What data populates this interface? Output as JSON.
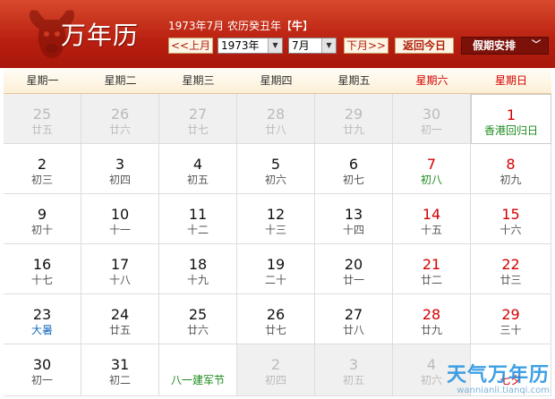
{
  "header": {
    "app_title": "万年历",
    "lunar_info_prefix": "1973年7月 农历癸丑年【",
    "zodiac": "牛",
    "lunar_info_suffix": "】",
    "prev_month_label": "<<上月",
    "next_month_label": "下月>>",
    "today_label": "返回今日",
    "holiday_label": "假期安排",
    "year_value": "1973年",
    "month_value": "7月"
  },
  "weekdays": [
    "星期一",
    "星期二",
    "星期三",
    "星期四",
    "星期五",
    "星期六",
    "星期日"
  ],
  "weeks": [
    [
      {
        "day": "25",
        "lunar": "廿五",
        "other": true
      },
      {
        "day": "26",
        "lunar": "廿六",
        "other": true
      },
      {
        "day": "27",
        "lunar": "廿七",
        "other": true
      },
      {
        "day": "28",
        "lunar": "廿八",
        "other": true
      },
      {
        "day": "29",
        "lunar": "廿九",
        "other": true
      },
      {
        "day": "30",
        "lunar": "初一",
        "other": true
      },
      {
        "day": "1",
        "lunar": "香港回归日",
        "kind": "festival"
      }
    ],
    [
      {
        "day": "2",
        "lunar": "初三"
      },
      {
        "day": "3",
        "lunar": "初四"
      },
      {
        "day": "4",
        "lunar": "初五"
      },
      {
        "day": "5",
        "lunar": "初六"
      },
      {
        "day": "6",
        "lunar": "初七"
      },
      {
        "day": "7",
        "lunar": "初八",
        "kind": "festival"
      },
      {
        "day": "8",
        "lunar": "初九"
      }
    ],
    [
      {
        "day": "9",
        "lunar": "初十"
      },
      {
        "day": "10",
        "lunar": "十一"
      },
      {
        "day": "11",
        "lunar": "十二"
      },
      {
        "day": "12",
        "lunar": "十三"
      },
      {
        "day": "13",
        "lunar": "十四"
      },
      {
        "day": "14",
        "lunar": "十五"
      },
      {
        "day": "15",
        "lunar": "十六"
      }
    ],
    [
      {
        "day": "16",
        "lunar": "十七"
      },
      {
        "day": "17",
        "lunar": "十八"
      },
      {
        "day": "18",
        "lunar": "十九"
      },
      {
        "day": "19",
        "lunar": "二十"
      },
      {
        "day": "20",
        "lunar": "廿一"
      },
      {
        "day": "21",
        "lunar": "廿二"
      },
      {
        "day": "22",
        "lunar": "廿三"
      }
    ],
    [
      {
        "day": "23",
        "lunar": "大暑",
        "kind": "solar-term"
      },
      {
        "day": "24",
        "lunar": "廿五"
      },
      {
        "day": "25",
        "lunar": "廿六"
      },
      {
        "day": "26",
        "lunar": "廿七"
      },
      {
        "day": "27",
        "lunar": "廿八"
      },
      {
        "day": "28",
        "lunar": "廿九"
      },
      {
        "day": "29",
        "lunar": "三十"
      }
    ],
    [
      {
        "day": "30",
        "lunar": "初一"
      },
      {
        "day": "31",
        "lunar": "初二"
      },
      {
        "day": "",
        "lunar": "八一建军节",
        "kind": "festival"
      },
      {
        "day": "2",
        "lunar": "初四",
        "other": true
      },
      {
        "day": "3",
        "lunar": "初五",
        "other": true
      },
      {
        "day": "4",
        "lunar": "初六",
        "other": true
      },
      {
        "day": "",
        "lunar": "七夕",
        "kind": "red"
      }
    ]
  ],
  "watermark": {
    "title": "天气万年历",
    "url": "wannianli.tianqi.com"
  },
  "colors": {
    "header_red": "#b91f10",
    "weekend_red": "#d40000",
    "festival_green": "#1b8a1b",
    "solar_term_blue": "#1a6fc0"
  }
}
